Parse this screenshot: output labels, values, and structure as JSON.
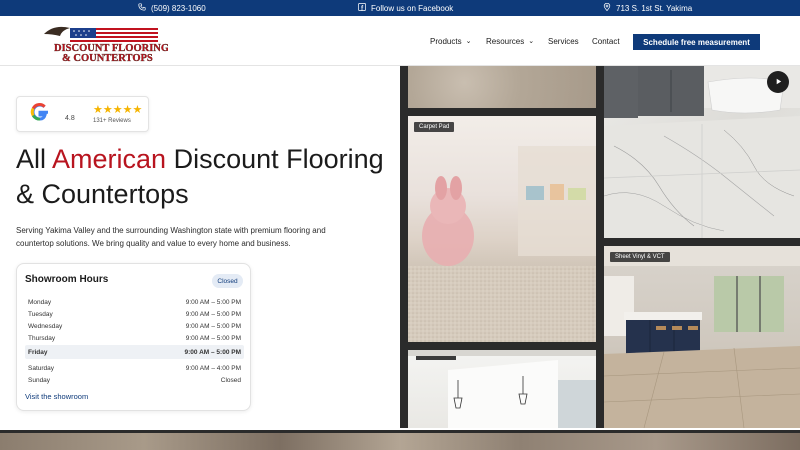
{
  "topbar": {
    "phone": "(509) 823-1060",
    "facebook": "Follow us on Facebook",
    "address": "713 S. 1st St. Yakima"
  },
  "header": {
    "logo_text_line1": "DISCOUNT FLOORING",
    "logo_text_line2": "& COUNTERTOPS",
    "nav": [
      "Products",
      "Resources",
      "Services",
      "Contact"
    ],
    "cta": "Schedule free measurement"
  },
  "reviews": {
    "score": "4.8",
    "stars": "★★★★★",
    "count": "131+ Reviews"
  },
  "hero": {
    "title_prefix": "All ",
    "title_accent": "American",
    "title_rest": " Discount Flooring & Countertops",
    "description": "Serving Yakima Valley and the surrounding Washington state with premium flooring and countertop solutions. We bring quality and value to every home and business."
  },
  "hours": {
    "title": "Showroom Hours",
    "status": "Closed",
    "rows": [
      {
        "day": "Monday",
        "time": "9:00 AM – 5:00 PM"
      },
      {
        "day": "Tuesday",
        "time": "9:00 AM – 5:00 PM"
      },
      {
        "day": "Wednesday",
        "time": "9:00 AM – 5:00 PM"
      },
      {
        "day": "Thursday",
        "time": "9:00 AM – 5:00 PM"
      },
      {
        "day": "Friday",
        "time": "9:00 AM – 5:00 PM"
      },
      {
        "day": "Saturday",
        "time": "9:00 AM – 4:00 PM"
      },
      {
        "day": "Sunday",
        "time": "Closed"
      }
    ],
    "visit_link": "Visit the showroom"
  },
  "gallery": {
    "carpet_label": "Carpet Pad",
    "vinyl_label": "Sheet Vinyl & VCT"
  },
  "colors": {
    "brand_blue": "#0e3a7a",
    "accent_red": "#b8141f",
    "star_gold": "#f5b400"
  }
}
